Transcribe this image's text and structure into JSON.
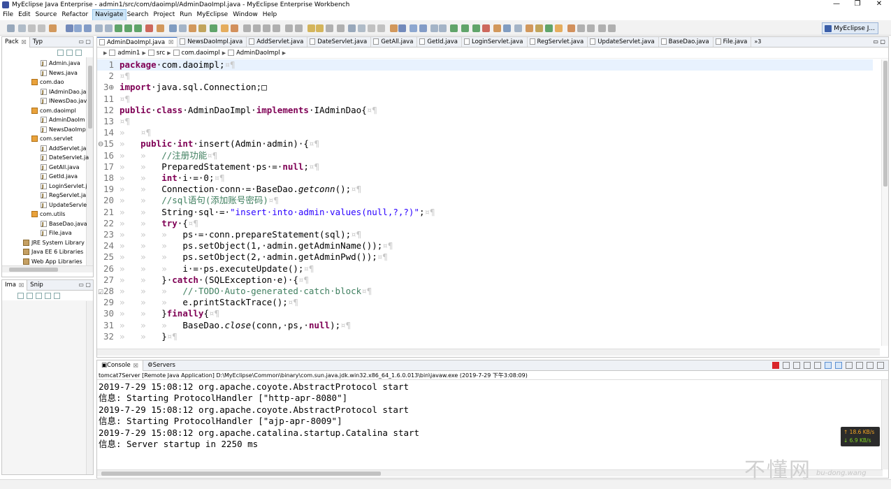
{
  "window": {
    "title": "MyEclipse Java Enterprise - admin1/src/com/daoimpl/AdminDaoImpl.java - MyEclipse Enterprise Workbench",
    "minimize": "—",
    "maximize": "❐",
    "close": "✕"
  },
  "menu": [
    "File",
    "Edit",
    "Source",
    "Refactor",
    "Navigate",
    "Search",
    "Project",
    "Run",
    "MyEclipse",
    "Window",
    "Help"
  ],
  "menu_active_index": 4,
  "perspective": {
    "label": "MyEclipse J..."
  },
  "left_panel": {
    "tabs": [
      {
        "label": "Pack",
        "close": "☒"
      },
      {
        "label": "Typ"
      }
    ],
    "tree": [
      {
        "label": "Admin.java",
        "kind": "file",
        "indent": 2
      },
      {
        "label": "News.java",
        "kind": "file",
        "indent": 2
      },
      {
        "label": "com.dao",
        "kind": "package",
        "indent": 1
      },
      {
        "label": "IAdminDao.ja",
        "kind": "file",
        "indent": 2
      },
      {
        "label": "INewsDao.jav",
        "kind": "file",
        "indent": 2
      },
      {
        "label": "com.daoimpl",
        "kind": "package",
        "indent": 1
      },
      {
        "label": "AdminDaoIm",
        "kind": "file",
        "indent": 2
      },
      {
        "label": "NewsDaoImp",
        "kind": "file",
        "indent": 2
      },
      {
        "label": "com.servlet",
        "kind": "package",
        "indent": 1
      },
      {
        "label": "AddServlet.ja",
        "kind": "file",
        "indent": 2
      },
      {
        "label": "DateServlet.ja",
        "kind": "file",
        "indent": 2
      },
      {
        "label": "GetAll.java",
        "kind": "file",
        "indent": 2
      },
      {
        "label": "GetId.java",
        "kind": "file",
        "indent": 2
      },
      {
        "label": "LoginServlet.j",
        "kind": "file",
        "indent": 2
      },
      {
        "label": "RegServlet.ja",
        "kind": "file",
        "indent": 2
      },
      {
        "label": "UpdateServle",
        "kind": "file",
        "indent": 2
      },
      {
        "label": "com.utils",
        "kind": "package",
        "indent": 1
      },
      {
        "label": "BaseDao.java",
        "kind": "file",
        "indent": 2
      },
      {
        "label": "File.java",
        "kind": "file",
        "indent": 2
      },
      {
        "label": "JRE System Library",
        "kind": "library",
        "indent": 0
      },
      {
        "label": "Java EE 6 Libraries",
        "kind": "library",
        "indent": 0
      },
      {
        "label": "Web App Libraries",
        "kind": "library",
        "indent": 0
      }
    ]
  },
  "left_panel2": {
    "tabs": [
      {
        "label": "Ima",
        "close": "☒"
      },
      {
        "label": "Snip"
      }
    ]
  },
  "editor": {
    "tabs": [
      {
        "label": "AdminDaoImpl.java",
        "selected": true,
        "close": "☒"
      },
      {
        "label": "NewsDaoImpl.java"
      },
      {
        "label": "AddServlet.java"
      },
      {
        "label": "DateServlet.java"
      },
      {
        "label": "GetAll.java"
      },
      {
        "label": "GetId.java"
      },
      {
        "label": "LoginServlet.java"
      },
      {
        "label": "RegServlet.java"
      },
      {
        "label": "UpdateServlet.java"
      },
      {
        "label": "BaseDao.java"
      },
      {
        "label": "File.java"
      }
    ],
    "more_tabs": "»3",
    "breadcrumb": [
      "admin1",
      "src",
      "com.daoimpl",
      "AdminDaoImpl"
    ],
    "lines": [
      {
        "n": "1",
        "t": [
          [
            "kw",
            "package"
          ],
          [
            "",
            "·com.daoimpl;"
          ],
          [
            "ws",
            "¤¶"
          ]
        ]
      },
      {
        "n": "2",
        "t": [
          [
            "ws",
            "¤¶"
          ]
        ]
      },
      {
        "n": "3⊕",
        "t": [
          [
            "kw",
            "import"
          ],
          [
            "",
            "·java.sql.Connection;□"
          ]
        ]
      },
      {
        "n": "11",
        "t": [
          [
            "ws",
            "¤¶"
          ]
        ]
      },
      {
        "n": "12",
        "t": [
          [
            "kw",
            "public"
          ],
          [
            "",
            "·"
          ],
          [
            "kw",
            "class"
          ],
          [
            "",
            "·AdminDaoImpl·"
          ],
          [
            "kw",
            "implements"
          ],
          [
            "",
            "·IAdminDao{"
          ],
          [
            "ws",
            "¤¶"
          ]
        ]
      },
      {
        "n": "13",
        "t": [
          [
            "ws",
            "¤¶"
          ]
        ]
      },
      {
        "n": "14",
        "t": [
          [
            "ws",
            "»   ¤¶"
          ]
        ]
      },
      {
        "n": "⊖15",
        "t": [
          [
            "ws",
            "»   "
          ],
          [
            "kw",
            "public"
          ],
          [
            "",
            "·"
          ],
          [
            "kw",
            "int"
          ],
          [
            "",
            "·insert(Admin·admin)·{"
          ],
          [
            "ws",
            "¤¶"
          ]
        ]
      },
      {
        "n": "16",
        "t": [
          [
            "ws",
            "»   »   "
          ],
          [
            "cm",
            "//注册功能"
          ],
          [
            "ws",
            "¤¶"
          ]
        ]
      },
      {
        "n": "17",
        "t": [
          [
            "ws",
            "»   »   "
          ],
          [
            "",
            "PreparedStatement·ps·=·"
          ],
          [
            "kw",
            "null"
          ],
          [
            "",
            ";"
          ],
          [
            "ws",
            "¤¶"
          ]
        ]
      },
      {
        "n": "18",
        "t": [
          [
            "ws",
            "»   »   "
          ],
          [
            "kw",
            "int"
          ],
          [
            "",
            "·i·=·0;"
          ],
          [
            "ws",
            "¤¶"
          ]
        ]
      },
      {
        "n": "19",
        "t": [
          [
            "ws",
            "»   »   "
          ],
          [
            "",
            "Connection·conn·=·BaseDao."
          ],
          [
            "it",
            "getconn"
          ],
          [
            "",
            "();"
          ],
          [
            "ws",
            "¤¶"
          ]
        ]
      },
      {
        "n": "20",
        "t": [
          [
            "ws",
            "»   »   "
          ],
          [
            "cm",
            "//sql语句(添加账号密码)"
          ],
          [
            "ws",
            "¤¶"
          ]
        ]
      },
      {
        "n": "21",
        "t": [
          [
            "ws",
            "»   »   "
          ],
          [
            "",
            "String·sql·=·"
          ],
          [
            "st",
            "\"insert·into·admin·values(null,?,?)\""
          ],
          [
            "",
            ";"
          ],
          [
            "ws",
            "¤¶"
          ]
        ]
      },
      {
        "n": "22",
        "t": [
          [
            "ws",
            "»   »   "
          ],
          [
            "kw",
            "try"
          ],
          [
            "",
            "·{"
          ],
          [
            "ws",
            "¤¶"
          ]
        ]
      },
      {
        "n": "23",
        "t": [
          [
            "ws",
            "»   »   »   "
          ],
          [
            "",
            "ps·=·conn.prepareStatement(sql);"
          ],
          [
            "ws",
            "¤¶"
          ]
        ]
      },
      {
        "n": "24",
        "t": [
          [
            "ws",
            "»   »   »   "
          ],
          [
            "",
            "ps.setObject(1,·admin.getAdminName());"
          ],
          [
            "ws",
            "¤¶"
          ]
        ]
      },
      {
        "n": "25",
        "t": [
          [
            "ws",
            "»   »   »   "
          ],
          [
            "",
            "ps.setObject(2,·admin.getAdminPwd());"
          ],
          [
            "ws",
            "¤¶"
          ]
        ]
      },
      {
        "n": "26",
        "t": [
          [
            "ws",
            "»   »   »   "
          ],
          [
            "",
            "i·=·ps.executeUpdate();"
          ],
          [
            "ws",
            "¤¶"
          ]
        ]
      },
      {
        "n": "27",
        "t": [
          [
            "ws",
            "»   »   "
          ],
          [
            "",
            "}·"
          ],
          [
            "kw",
            "catch"
          ],
          [
            "",
            "·(SQLException·e)·{"
          ],
          [
            "ws",
            "¤¶"
          ]
        ]
      },
      {
        "n": "☑28",
        "t": [
          [
            "ws",
            "»   »   »   "
          ],
          [
            "cm",
            "//·TODO·Auto-generated·catch·block"
          ],
          [
            "ws",
            "¤¶"
          ]
        ]
      },
      {
        "n": "29",
        "t": [
          [
            "ws",
            "»   »   »   "
          ],
          [
            "",
            "e.printStackTrace();"
          ],
          [
            "ws",
            "¤¶"
          ]
        ]
      },
      {
        "n": "30",
        "t": [
          [
            "ws",
            "»   »   "
          ],
          [
            "",
            "}"
          ],
          [
            "kw",
            "finally"
          ],
          [
            "",
            "{"
          ],
          [
            "ws",
            "¤¶"
          ]
        ]
      },
      {
        "n": "31",
        "t": [
          [
            "ws",
            "»   »   »   "
          ],
          [
            "",
            "BaseDao."
          ],
          [
            "it",
            "close"
          ],
          [
            "",
            "(conn,·ps,·"
          ],
          [
            "kw",
            "null"
          ],
          [
            "",
            ");"
          ],
          [
            "ws",
            "¤¶"
          ]
        ]
      },
      {
        "n": "32",
        "t": [
          [
            "ws",
            "»   »   "
          ],
          [
            "",
            "}"
          ],
          [
            "ws",
            "¤¶"
          ]
        ]
      }
    ]
  },
  "console": {
    "tabs": [
      {
        "label": "Console",
        "close": "☒"
      },
      {
        "label": "Servers"
      }
    ],
    "info": "tomcat7Server [Remote Java Application] D:\\MyEclipse\\Common\\binary\\com.sun.java.jdk.win32.x86_64_1.6.0.013\\bin\\javaw.exe (2019-7-29 下午3:08:09)",
    "lines": [
      "2019-7-29 15:08:12 org.apache.coyote.AbstractProtocol start",
      "信息: Starting ProtocolHandler [\"http-apr-8080\"]",
      "2019-7-29 15:08:12 org.apache.coyote.AbstractProtocol start",
      "信息: Starting ProtocolHandler [\"ajp-apr-8009\"]",
      "2019-7-29 15:08:12 org.apache.catalina.startup.Catalina start",
      "信息: Server startup in 2250 ms"
    ]
  },
  "network": {
    "up": "↑ 18.6 KB/s",
    "down": "↓ 6.9 KB/s"
  },
  "watermark": {
    "main": "不懂网",
    "sub": "bu-dong.wang"
  },
  "colors": {
    "keyword": "#7f0055",
    "comment": "#3f7f5f",
    "string": "#2a00ff",
    "current_line": "#e8f2fe",
    "selected_tab_border": "#3a70c4"
  }
}
